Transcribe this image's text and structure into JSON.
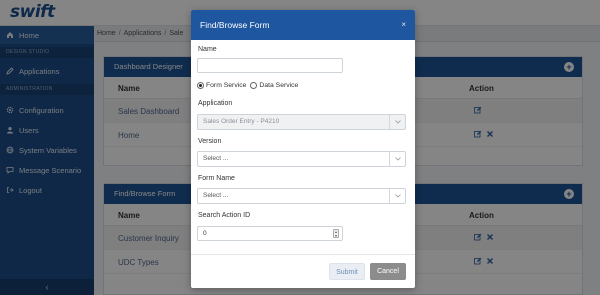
{
  "app": {
    "logo": "swift"
  },
  "sidebar": {
    "home": "Home",
    "section_design": "DESIGN STUDIO",
    "applications": "Applications",
    "section_admin": "ADMINISTRATION",
    "configuration": "Configuration",
    "users": "Users",
    "system_variables": "System Variables",
    "message_scenario": "Message Scenario",
    "logout": "Logout",
    "collapse_glyph": "‹"
  },
  "breadcrumb": {
    "items": [
      "Home",
      "Applications",
      "Sale"
    ],
    "separator": "/"
  },
  "panels": {
    "dashboard": {
      "title": "Dashboard Designer",
      "col_name": "Name",
      "col_action": "Action",
      "rows": [
        "Sales Dashboard",
        "Home"
      ]
    },
    "findbrowse": {
      "title": "Find/Browse Form",
      "col_name": "Name",
      "col_action": "Action",
      "rows": [
        "Customer Inquiry",
        "UDC Types"
      ]
    }
  },
  "modal": {
    "title": "Find/Browse Form",
    "close": "×",
    "name_label": "Name",
    "name_value": "",
    "radio_form_service": "Form Service",
    "radio_data_service": "Data Service",
    "selected_service": "Form Service",
    "application_label": "Application",
    "application_value": "Sales Order Entry - P4210",
    "version_label": "Version",
    "version_value": "Select ...",
    "form_name_label": "Form Name",
    "form_name_value": "Select ...",
    "search_action_label": "Search Action ID",
    "search_action_value": "0",
    "submit": "Submit",
    "cancel": "Cancel"
  },
  "colors": {
    "sidebar": "#1d4e89",
    "panel_header": "#1d5596",
    "modal_header": "#1e56a0",
    "cancel_button": "#8c8c8c"
  }
}
